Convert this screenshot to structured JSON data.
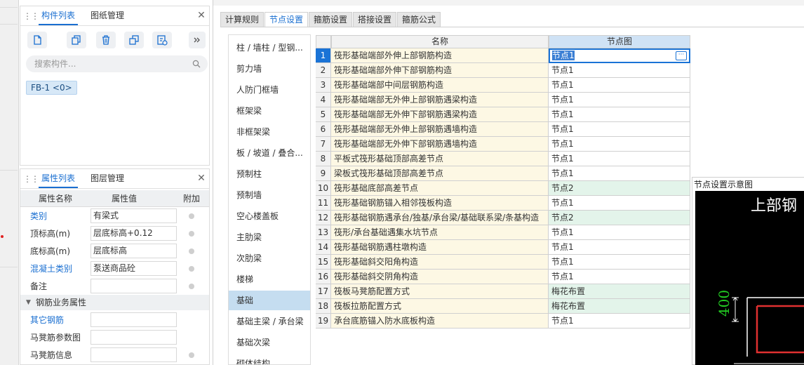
{
  "component_panel": {
    "tabs": [
      "构件列表",
      "图纸管理"
    ],
    "search_placeholder": "搜索构件...",
    "component_chip": "FB-1 <0>"
  },
  "property_panel": {
    "tabs": [
      "属性列表",
      "图层管理"
    ],
    "columns": [
      "属性名称",
      "属性值",
      "附加"
    ],
    "rows": [
      {
        "name": "类别",
        "value": "有梁式"
      },
      {
        "name": "顶标高(m)",
        "value": "层底标高+0.12"
      },
      {
        "name": "底标高(m)",
        "value": "层底标高"
      },
      {
        "name": "混凝土类别",
        "value": "泵送商品砼"
      },
      {
        "name": "备注",
        "value": ""
      }
    ],
    "group": "钢筋业务属性",
    "group_rows": [
      {
        "name": "其它钢筋",
        "value": ""
      },
      {
        "name": "马凳筋参数图",
        "value": ""
      },
      {
        "name": "马凳筋信息",
        "value": ""
      }
    ]
  },
  "settings": {
    "tabs": [
      "计算规则",
      "节点设置",
      "箍筋设置",
      "搭接设置",
      "箍筋公式"
    ],
    "categories": [
      "柱 / 墙柱 / 型钢...",
      "剪力墙",
      "人防门框墙",
      "框架梁",
      "非框架梁",
      "板 / 坡道 / 叠合...",
      "预制柱",
      "预制墙",
      "空心楼盖板",
      "主肋梁",
      "次肋梁",
      "楼梯",
      "基础",
      "基础主梁 / 承台梁",
      "基础次梁",
      "砌体结构"
    ],
    "selected_category": "基础",
    "table": {
      "headers": [
        "名称",
        "节点图"
      ],
      "rows": [
        {
          "no": "1",
          "name": "筏形基础端部外伸上部钢筋构造",
          "node": "节点1"
        },
        {
          "no": "2",
          "name": "筏形基础端部外伸下部钢筋构造",
          "node": "节点1"
        },
        {
          "no": "3",
          "name": "筏形基础端部中间层钢筋构造",
          "node": "节点1"
        },
        {
          "no": "4",
          "name": "筏形基础端部无外伸上部钢筋遇梁构造",
          "node": "节点1"
        },
        {
          "no": "5",
          "name": "筏形基础端部无外伸下部钢筋遇梁构造",
          "node": "节点1"
        },
        {
          "no": "6",
          "name": "筏形基础端部无外伸上部钢筋遇墙构造",
          "node": "节点1"
        },
        {
          "no": "7",
          "name": "筏形基础端部无外伸下部钢筋遇墙构造",
          "node": "节点1"
        },
        {
          "no": "8",
          "name": "平板式筏形基础顶部高差节点",
          "node": "节点1"
        },
        {
          "no": "9",
          "name": "梁板式筏形基础顶部高差节点",
          "node": "节点1"
        },
        {
          "no": "10",
          "name": "筏形基础底部高差节点",
          "node": "节点2"
        },
        {
          "no": "11",
          "name": "筏形基础钢筋锚入相邻筏板构造",
          "node": "节点1"
        },
        {
          "no": "12",
          "name": "筏形基础钢筋遇承台/独基/承台梁/基础联系梁/条基构造",
          "node": "节点2"
        },
        {
          "no": "13",
          "name": "筏形/承台基础遇集水坑节点",
          "node": "节点1"
        },
        {
          "no": "14",
          "name": "筏形基础钢筋遇柱墩构造",
          "node": "节点1"
        },
        {
          "no": "15",
          "name": "筏形基础斜交阳角构造",
          "node": "节点1"
        },
        {
          "no": "16",
          "name": "筏形基础斜交阴角构造",
          "node": "节点1"
        },
        {
          "no": "17",
          "name": "筏板马凳筋配置方式",
          "node": "梅花布置"
        },
        {
          "no": "18",
          "name": "筏板拉筋配置方式",
          "node": "梅花布置"
        },
        {
          "no": "19",
          "name": "承台底筋锚入防水底板构造",
          "node": "节点1"
        }
      ]
    },
    "preview": {
      "title": "节点设置示意图",
      "caption": "上部钢",
      "dimension": "400"
    }
  },
  "colors": {
    "accent": "#1a6fd1",
    "name_cell_bg": "#fdf8e4",
    "modified_cell_bg": "#e3f4ea",
    "preview_bg": "#000000",
    "preview_dim_green": "#22cc22",
    "preview_rebar_red": "#e03030"
  }
}
